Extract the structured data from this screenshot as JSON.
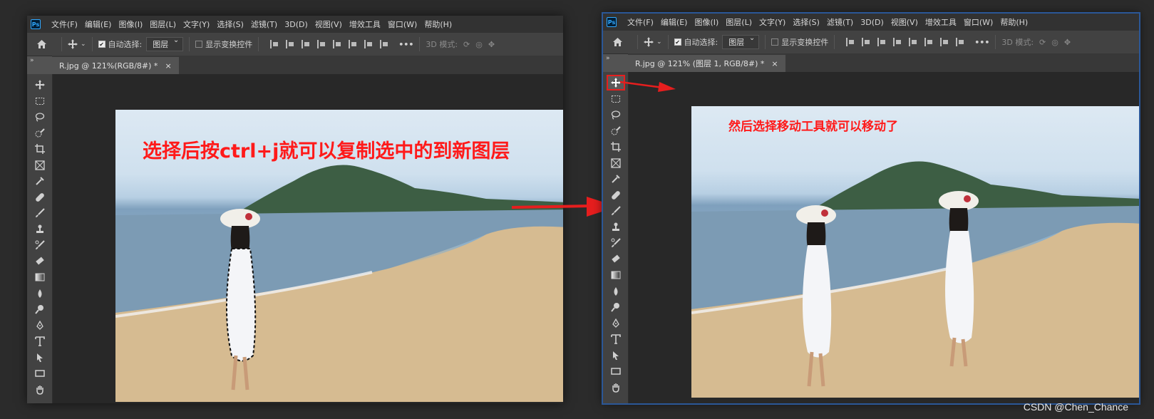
{
  "app": {
    "logo": "Ps",
    "menu": [
      "文件(F)",
      "编辑(E)",
      "图像(I)",
      "图层(L)",
      "文字(Y)",
      "选择(S)",
      "滤镜(T)",
      "3D(D)",
      "视图(V)",
      "增效工具",
      "窗口(W)",
      "帮助(H)"
    ]
  },
  "options_bar": {
    "auto_select_label": "自动选择:",
    "auto_select_checked": true,
    "target_dropdown": "图层",
    "show_transform_label": "显示变换控件",
    "show_transform_checked": false,
    "more_label": "•••",
    "mode_3d_label": "3D 模式:"
  },
  "left_window": {
    "tab_title": "R.jpg @ 121%(RGB/8#) *",
    "annotation": "选择后按ctrl+j就可以复制选中的到新图层"
  },
  "right_window": {
    "tab_title": "R.jpg @ 121% (图层 1, RGB/8#) *",
    "annotation": "然后选择移动工具就可以移动了"
  },
  "tab_close": "×",
  "collapse_arrows": "»",
  "tools": [
    "move-tool",
    "marquee-tool",
    "lasso-tool",
    "quick-select-tool",
    "crop-tool",
    "frame-tool",
    "eyedropper-tool",
    "healing-tool",
    "brush-tool",
    "stamp-tool",
    "history-brush-tool",
    "eraser-tool",
    "gradient-tool",
    "blur-tool",
    "dodge-tool",
    "pen-tool",
    "type-tool",
    "path-select-tool",
    "rectangle-tool",
    "hand-tool"
  ],
  "colors": {
    "annotation_red": "#ff1a1a",
    "highlight_red": "#e61e1e",
    "window_outline": "#2b5797"
  },
  "watermark": "CSDN @Chen_Chance"
}
